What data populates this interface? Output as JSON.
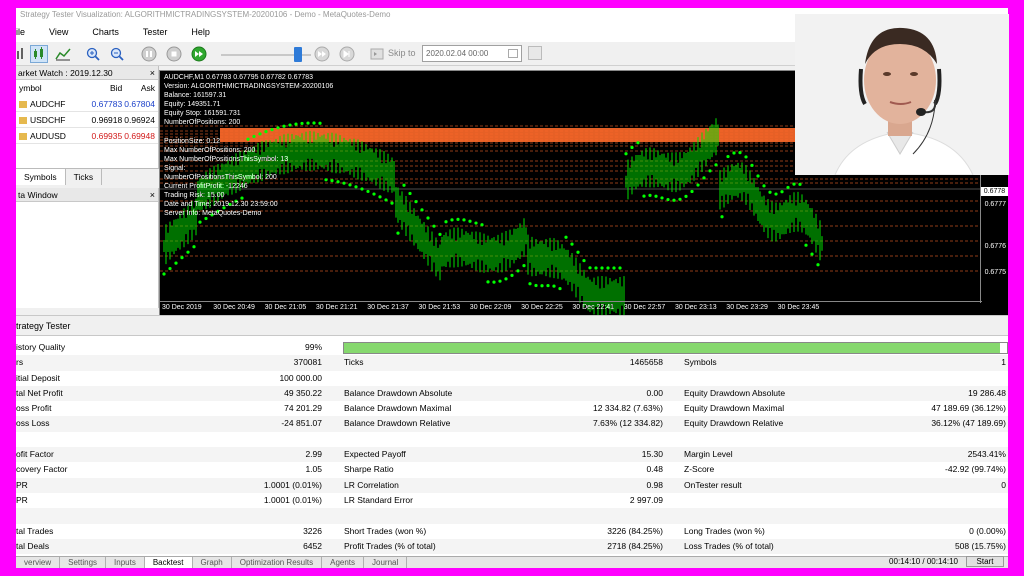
{
  "window": {
    "title": "Strategy Tester Visualization: ALGORITHMICTRADINGSYSTEM-20200106 - Demo - MetaQuotes-Demo"
  },
  "menu": [
    "ile",
    "View",
    "Charts",
    "Tester",
    "Help"
  ],
  "toolbar": {
    "skip_label": "Skip to",
    "skip_date": "2020.02.04 00:00",
    "speed_percent": 85
  },
  "market_watch": {
    "title": "arket Watch : 2019.12.30",
    "columns": [
      "ymbol",
      "Bid",
      "Ask"
    ],
    "rows": [
      {
        "symbol": "AUDCHF",
        "bid": "0.67783",
        "ask": "0.67804",
        "color": "blue"
      },
      {
        "symbol": "USDCHF",
        "bid": "0.96918",
        "ask": "0.96924",
        "color": "black"
      },
      {
        "symbol": "AUDUSD",
        "bid": "0.69935",
        "ask": "0.69948",
        "color": "red"
      }
    ],
    "tabs": [
      "Symbols",
      "Ticks"
    ]
  },
  "data_window": {
    "title": "ta Window"
  },
  "chart": {
    "info_lines": [
      "AUDCHF,M1  0.67783 0.67795 0.67782 0.67783",
      "Version: ALGORITHMICTRADINGSYSTEM-20200106",
      "Balance: 161597.31",
      "Equity: 149351.71",
      "Equity Stop: 161591.731",
      "NumberOfPositions: 200",
      "",
      "PositionSize: 0.12",
      "Max NumberOfPositions: 200",
      "Max NumberOfPositionsThisSymbol: 13",
      "Signal:",
      "NumberOfPositionsThisSymbol: 200",
      "Current ProfitProfit: -12246",
      "Trading Risk: 15.00",
      "Date and Time: 2019.12.30 23:59:00",
      "Server Info: MetaQuotes-Demo"
    ],
    "price_ticks": [
      "0.6778",
      "0.6777",
      "0.6776",
      "0.6775"
    ],
    "current_price": "0.6778",
    "time_ticks": [
      "30 Dec 2019",
      "30 Dec 20:49",
      "30 Dec 21:05",
      "30 Dec 21:21",
      "30 Dec 21:37",
      "30 Dec 21:53",
      "30 Dec 22:09",
      "30 Dec 22:25",
      "30 Dec 22:41",
      "30 Dec 22:57",
      "30 Dec 23:13",
      "30 Dec 23:29",
      "30 Dec 23:45"
    ]
  },
  "tester": {
    "title": "trategy Tester",
    "history_quality": {
      "label": "istory Quality",
      "value": "99%",
      "fraction": 0.99
    },
    "rows": [
      [
        {
          "l": "rs",
          "v": "370081"
        },
        {
          "l": "Ticks",
          "v": "1465658"
        },
        {
          "l": "Symbols",
          "v": "1"
        }
      ],
      [
        {
          "l": "itial Deposit",
          "v": "100 000.00"
        },
        {
          "l": "",
          "v": ""
        },
        {
          "l": "",
          "v": ""
        }
      ],
      [
        {
          "l": "tal Net Profit",
          "v": "49 350.22"
        },
        {
          "l": "Balance Drawdown Absolute",
          "v": "0.00"
        },
        {
          "l": "Equity Drawdown Absolute",
          "v": "19 286.48"
        }
      ],
      [
        {
          "l": "oss Profit",
          "v": "74 201.29"
        },
        {
          "l": "Balance Drawdown Maximal",
          "v": "12 334.82 (7.63%)"
        },
        {
          "l": "Equity Drawdown Maximal",
          "v": "47 189.69 (36.12%)"
        }
      ],
      [
        {
          "l": "oss Loss",
          "v": "-24 851.07"
        },
        {
          "l": "Balance Drawdown Relative",
          "v": "7.63% (12 334.82)"
        },
        {
          "l": "Equity Drawdown Relative",
          "v": "36.12% (47 189.69)"
        }
      ],
      [
        {
          "l": "",
          "v": ""
        },
        {
          "l": "",
          "v": ""
        },
        {
          "l": "",
          "v": ""
        }
      ],
      [
        {
          "l": "ofit Factor",
          "v": "2.99"
        },
        {
          "l": "Expected Payoff",
          "v": "15.30"
        },
        {
          "l": "Margin Level",
          "v": "2543.41%"
        }
      ],
      [
        {
          "l": "covery Factor",
          "v": "1.05"
        },
        {
          "l": "Sharpe Ratio",
          "v": "0.48"
        },
        {
          "l": "Z-Score",
          "v": "-42.92 (99.74%)"
        }
      ],
      [
        {
          "l": "PR",
          "v": "1.0001 (0.01%)"
        },
        {
          "l": "LR Correlation",
          "v": "0.98"
        },
        {
          "l": "OnTester result",
          "v": "0"
        }
      ],
      [
        {
          "l": "PR",
          "v": "1.0001 (0.01%)"
        },
        {
          "l": "LR Standard Error",
          "v": "2 997.09"
        },
        {
          "l": "",
          "v": ""
        }
      ],
      [
        {
          "l": "",
          "v": ""
        },
        {
          "l": "",
          "v": ""
        },
        {
          "l": "",
          "v": ""
        }
      ],
      [
        {
          "l": "tal Trades",
          "v": "3226"
        },
        {
          "l": "Short Trades (won %)",
          "v": "3226 (84.25%)"
        },
        {
          "l": "Long Trades (won %)",
          "v": "0 (0.00%)"
        }
      ],
      [
        {
          "l": "tal Deals",
          "v": "6452"
        },
        {
          "l": "Profit Trades (% of total)",
          "v": "2718 (84.25%)"
        },
        {
          "l": "Loss Trades (% of total)",
          "v": "508 (15.75%)"
        }
      ]
    ],
    "tabs": [
      "verview",
      "Settings",
      "Inputs",
      "Backtest",
      "Graph",
      "Optimization Results",
      "Agents",
      "Journal"
    ],
    "active_tab": "Backtest",
    "timer": "00:14:10 / 00:14:10",
    "start_label": "Start"
  },
  "colors": {
    "accent_pink": "#ff00ff",
    "candle_green": "#00e000",
    "sar_green": "#00ff00",
    "order_line": "#ff6a2a",
    "quality_fill": "#86d86e"
  }
}
